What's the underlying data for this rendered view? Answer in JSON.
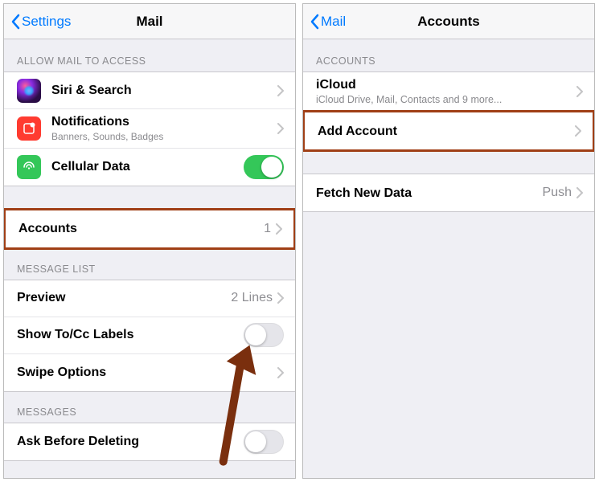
{
  "left": {
    "back_label": "Settings",
    "title": "Mail",
    "section_allow": "ALLOW MAIL TO ACCESS",
    "siri_label": "Siri & Search",
    "notif_label": "Notifications",
    "notif_sub": "Banners, Sounds, Badges",
    "cell_label": "Cellular Data",
    "accounts_label": "Accounts",
    "accounts_count": "1",
    "section_msglist": "MESSAGE LIST",
    "preview_label": "Preview",
    "preview_value": "2 Lines",
    "showtc_label": "Show To/Cc Labels",
    "swipe_label": "Swipe Options",
    "section_messages": "MESSAGES",
    "askdel_label": "Ask Before Deleting"
  },
  "right": {
    "back_label": "Mail",
    "title": "Accounts",
    "section_accounts": "ACCOUNTS",
    "icloud_label": "iCloud",
    "icloud_sub": "iCloud Drive, Mail, Contacts and 9 more...",
    "addacct_label": "Add Account",
    "fetch_label": "Fetch New Data",
    "fetch_value": "Push"
  }
}
